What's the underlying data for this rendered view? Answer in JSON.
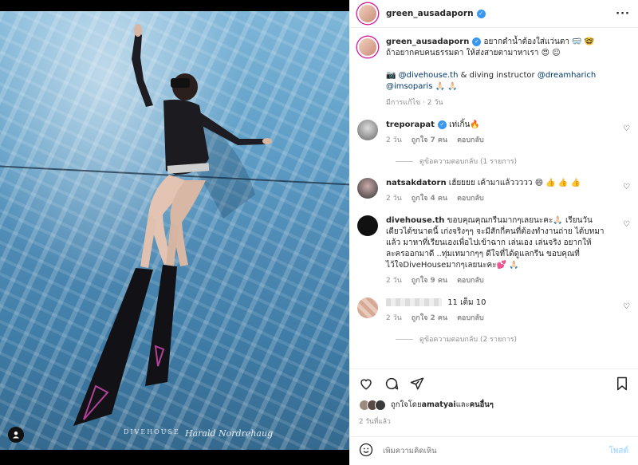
{
  "post": {
    "author": "green_ausadaporn",
    "more_icon": "more-horizontal-icon",
    "image": {
      "watermark_logo": "DIVEHOUSE",
      "watermark_signature": "Harald Nordrehaug"
    }
  },
  "caption": {
    "username": "green_ausadaporn",
    "text": "อยากดำน้ำต้องใส่แว่นตา 🥽 🤓",
    "text2": "ถ้าอยากคบคนธรรมดา ให้ส่งสายตามาหาเรา 😍 ☺",
    "camera": "📷",
    "credit_mention1": "@divehouse.th",
    "credit_mid": " & diving instructor ",
    "credit_mention2": "@dreamharich",
    "credit_mention3": "@imsoparis",
    "credit_tail": " 🙏🏻 🙏🏻",
    "meta": "มีการแก้ไข · 2 วัน"
  },
  "comments": [
    {
      "username": "treporapat",
      "text": "เท่เกิ้น🔥",
      "time": "2 วัน",
      "likes": "ถูกใจ 7 คน",
      "reply": "ตอบกลับ",
      "view_replies": "ดูข้อความตอบกลับ (1 รายการ)"
    },
    {
      "username": "natsakdatorn",
      "text": "เฮ้ยยยย เค้ามาแล้ววววว 😄 👍 👍 👍",
      "time": "2 วัน",
      "likes": "ถูกใจ 4 คน",
      "reply": "ตอบกลับ"
    },
    {
      "username": "divehouse.th",
      "text": "ขอบคุณคุณกรีนมากๆเลยนะคะ🙏🏻 เรียนวันเดียวได้ขนาดนี้ เก่งจริงๆๆ จะมีสักกี่คนที่ต้องทำงานถ่าย ได้บทมาแล้ว มาหาที่เรียนเองเพื่อไปเข้าฉาก เล่นเอง เล่นจริง อยากให้ละครออกมาดี ..ทุ่มเทมากๆๆ ดีใจที่ได้ดูแลกรีน ขอบคุณที่ไว้ใจDiveHouseมากๆเลยนะคะ💕 🙏🏻",
      "time": "2 วัน",
      "likes": "ถูกใจ 9 คน",
      "reply": "ตอบกลับ"
    },
    {
      "username": "",
      "text": "11 เต็ม 10",
      "time": "2 วัน",
      "likes": "ถูกใจ 2 คน",
      "reply": "ตอบกลับ",
      "view_replies": "ดูข้อความตอบกลับ (2 รายการ)"
    }
  ],
  "liked_by": {
    "prefix": "ถูกใจโดย ",
    "user": "amatyai",
    "mid": " และ",
    "others": "คนอื่นๆ"
  },
  "timestamp": "2 วันที่แล้ว",
  "add_comment": {
    "placeholder": "เพิ่มความคิดเห็น",
    "post_label": "โพสต์"
  },
  "colors": {
    "verified": "#3897f0",
    "mention": "#00376b",
    "post_button_disabled": "#b2dffc"
  }
}
